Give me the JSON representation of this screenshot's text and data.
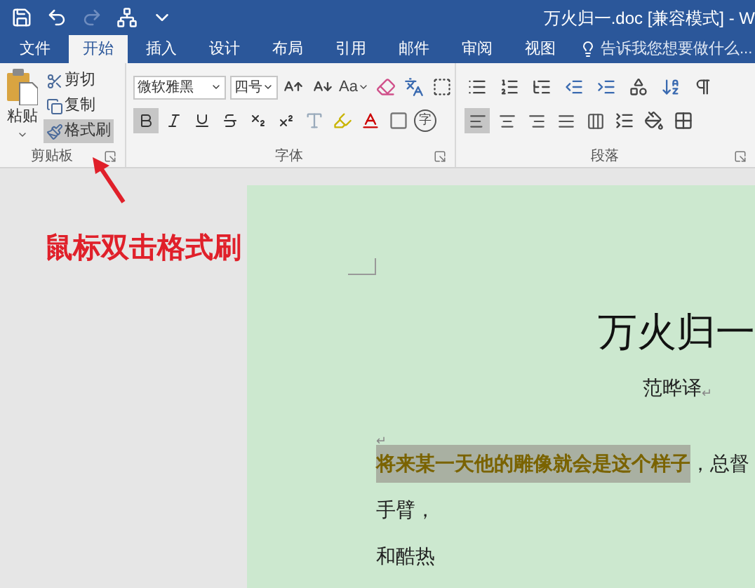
{
  "window": {
    "title": "万火归一.doc [兼容模式] - W"
  },
  "quick_access": [
    {
      "kind": "save",
      "disabled": false
    },
    {
      "kind": "undo",
      "disabled": false
    },
    {
      "kind": "redo",
      "disabled": true
    },
    {
      "kind": "tree",
      "disabled": false
    },
    {
      "kind": "customize",
      "disabled": false
    }
  ],
  "tabs": [
    {
      "label": "文件",
      "selected": false
    },
    {
      "label": "开始",
      "selected": true
    },
    {
      "label": "插入",
      "selected": false
    },
    {
      "label": "设计",
      "selected": false
    },
    {
      "label": "布局",
      "selected": false
    },
    {
      "label": "引用",
      "selected": false
    },
    {
      "label": "邮件",
      "selected": false
    },
    {
      "label": "审阅",
      "selected": false
    },
    {
      "label": "视图",
      "selected": false
    }
  ],
  "tell_me": {
    "placeholder": "告诉我您想要做什么..."
  },
  "clipboard": {
    "label": "剪贴板",
    "paste": "粘贴",
    "items": [
      {
        "label": "剪切",
        "kind": "cut",
        "selected": false
      },
      {
        "label": "复制",
        "kind": "copy",
        "selected": false
      },
      {
        "label": "格式刷",
        "kind": "painter",
        "selected": true
      }
    ]
  },
  "font": {
    "label": "字体",
    "name": "微软雅黑",
    "size": "四号",
    "case": "Aa",
    "enclose": "字",
    "buttons": [
      {
        "kind": "bold",
        "selected": true
      },
      {
        "kind": "italic",
        "selected": false
      },
      {
        "kind": "underline",
        "selected": false
      },
      {
        "kind": "strike",
        "selected": false
      },
      {
        "kind": "subscript",
        "selected": false
      },
      {
        "kind": "superscript",
        "selected": false
      }
    ]
  },
  "paragraph": {
    "label": "段落",
    "align": [
      {
        "kind": "left",
        "selected": true
      },
      {
        "kind": "center",
        "selected": false
      },
      {
        "kind": "right",
        "selected": false
      },
      {
        "kind": "justify",
        "selected": false
      },
      {
        "kind": "distribute",
        "selected": false
      }
    ]
  },
  "annotation": "鼠标双击格式刷",
  "document": {
    "title": "万火归一",
    "author": "范晔译",
    "author_mark": "↵",
    "blank_line": "↵",
    "lines": [
      {
        "segments": [
          {
            "text": "将来某一天他的雕像就会是这个样子",
            "highlighted": true
          },
          {
            "text": "，总督",
            "highlighted": false
          }
        ]
      },
      {
        "segments": [
          {
            "text": "手臂，",
            "highlighted": false
          }
        ]
      },
      {
        "segments": [
          {
            "text": "和酷热",
            "highlighted": false
          }
        ]
      }
    ]
  }
}
